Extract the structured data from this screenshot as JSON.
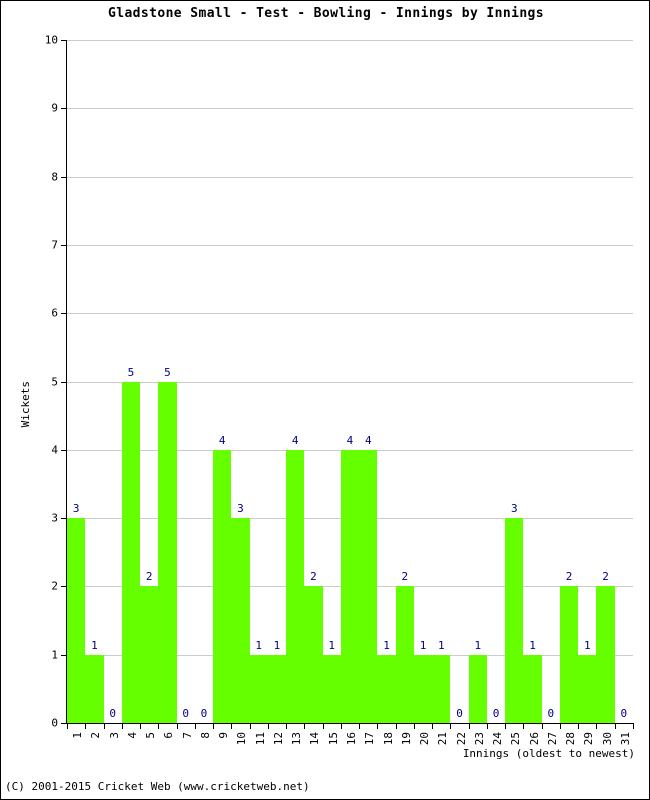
{
  "chart_data": {
    "type": "bar",
    "title": "Gladstone Small - Test - Bowling - Innings by Innings",
    "xlabel": "Innings (oldest to newest)",
    "ylabel": "Wickets",
    "ylim": [
      0,
      10
    ],
    "ytick_labels": [
      "0",
      "1",
      "2",
      "3",
      "4",
      "5",
      "6",
      "7",
      "8",
      "9",
      "10"
    ],
    "yticks": [
      0,
      1,
      2,
      3,
      4,
      5,
      6,
      7,
      8,
      9,
      10
    ],
    "grid": true,
    "legend": null,
    "bar_color": "#66ff00",
    "label_color": "#000080",
    "categories": [
      "1",
      "2",
      "3",
      "4",
      "5",
      "6",
      "7",
      "8",
      "9",
      "10",
      "11",
      "12",
      "13",
      "14",
      "15",
      "16",
      "17",
      "18",
      "19",
      "20",
      "21",
      "22",
      "23",
      "24",
      "25",
      "26",
      "27",
      "28",
      "29",
      "30",
      "31"
    ],
    "values": [
      3,
      1,
      0,
      5,
      2,
      5,
      0,
      0,
      4,
      3,
      1,
      1,
      4,
      2,
      1,
      4,
      4,
      1,
      2,
      1,
      1,
      0,
      1,
      0,
      3,
      1,
      0,
      2,
      1,
      2,
      0
    ],
    "data_labels": [
      "3",
      "1",
      "0",
      "5",
      "2",
      "5",
      "0",
      "0",
      "4",
      "3",
      "1",
      "1",
      "4",
      "2",
      "1",
      "4",
      "4",
      "1",
      "2",
      "1",
      "1",
      "0",
      "1",
      "0",
      "3",
      "1",
      "0",
      "2",
      "1",
      "2",
      "0"
    ]
  },
  "footer": {
    "copyright": "(C) 2001-2015 Cricket Web (www.cricketweb.net)"
  }
}
